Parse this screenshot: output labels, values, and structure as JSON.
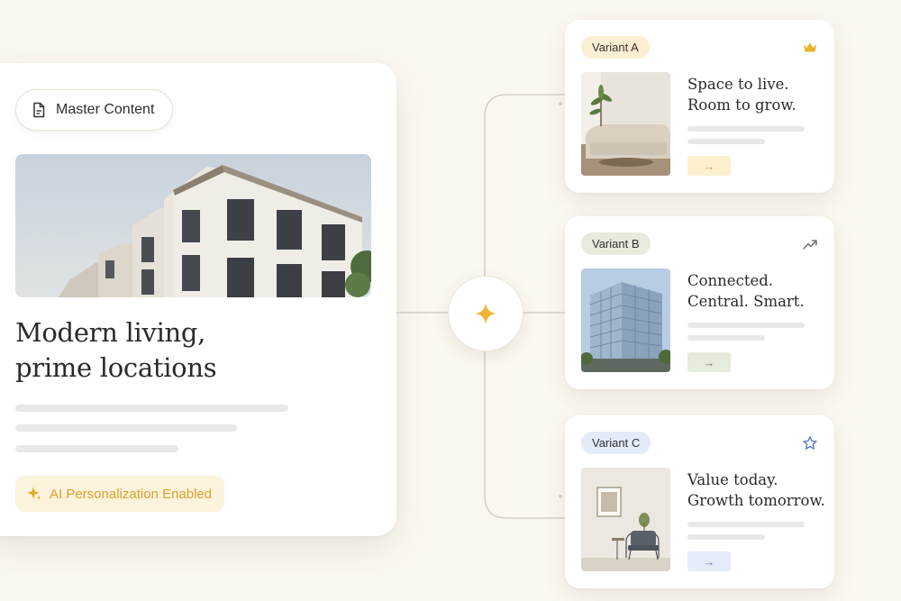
{
  "master": {
    "pill_label": "Master Content",
    "title_line1": "Modern living,",
    "title_line2": "prime locations",
    "ai_badge": "AI Personalization Enabled",
    "accent_color": "#d9a22a",
    "hero_image": "modern-townhouse-building-photo"
  },
  "hub": {
    "icon": "sparkle-icon"
  },
  "variants": [
    {
      "label": "Variant A",
      "icon": "crown-icon",
      "headline": "Space to live.\nRoom to grow.",
      "button": "→",
      "pill_color": "#fcefd1",
      "button_color": "#fdf0cf",
      "image": "living-room-sofa-photo"
    },
    {
      "label": "Variant B",
      "icon": "trending-up-icon",
      "headline": "Connected.\nCentral. Smart.",
      "button": "→",
      "pill_color": "#e6ebdc",
      "button_color": "#e6ecdc",
      "image": "glass-office-building-photo"
    },
    {
      "label": "Variant C",
      "icon": "star-icon",
      "headline": "Value today.\nGrowth tomorrow.",
      "button": "→",
      "pill_color": "#e3ebf8",
      "button_color": "#e4ecf9",
      "image": "minimal-room-armchair-photo"
    }
  ]
}
